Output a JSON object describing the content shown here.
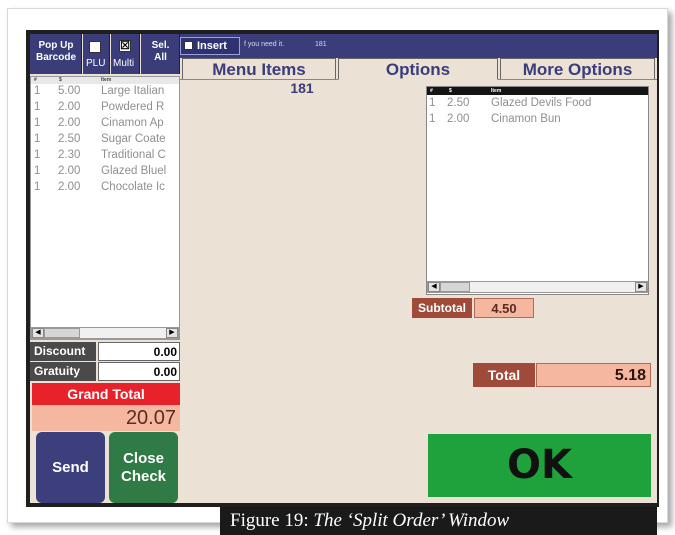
{
  "toolbar": {
    "popup_barcode": "Pop Up Barcode",
    "popup_line1": "Pop Up",
    "popup_line2": "Barcode",
    "plu_label": "PLU",
    "multi_label": "Multi",
    "multi_check": "☒",
    "sel_all_line1": "Sel.",
    "sel_all_line2": "All",
    "insert_label": "Insert",
    "hint_text": "f you need it.",
    "hint_number": "181"
  },
  "left_list": {
    "header": {
      "qty": "#",
      "price": "$",
      "item": "Item"
    },
    "rows": [
      {
        "qty": "1",
        "price": "5.00",
        "item": "Large Italian"
      },
      {
        "qty": "1",
        "price": "2.00",
        "item": "Powdered R"
      },
      {
        "qty": "1",
        "price": "2.00",
        "item": "Cinamon Ap"
      },
      {
        "qty": "1",
        "price": "2.50",
        "item": "Sugar Coate"
      },
      {
        "qty": "1",
        "price": "2.30",
        "item": "Traditional C"
      },
      {
        "qty": "1",
        "price": "2.00",
        "item": "Glazed Bluel"
      },
      {
        "qty": "1",
        "price": "2.00",
        "item": "Chocolate Ic"
      }
    ]
  },
  "summary": {
    "discount_label": "Discount",
    "discount_value": "0.00",
    "gratuity_label": "Gratuity",
    "gratuity_value": "0.00",
    "grand_total_label": "Grand Total",
    "grand_total_value": "20.07"
  },
  "buttons": {
    "send": "Send",
    "close_line1": "Close",
    "close_line2": "Check",
    "ok": "OK"
  },
  "tabs": [
    "Menu Items",
    "Options",
    "More Options"
  ],
  "order_number": "181",
  "options_list": {
    "header": {
      "qty": "#",
      "price": "$",
      "item": "Item"
    },
    "rows": [
      {
        "qty": "1",
        "price": "2.50",
        "item": "Glazed Devils Food"
      },
      {
        "qty": "1",
        "price": "2.00",
        "item": "Cinamon Bun"
      }
    ]
  },
  "totals": {
    "subtotal_label": "Subtotal",
    "subtotal_value": "4.50",
    "total_label": "Total",
    "total_value": "5.18"
  },
  "caption": {
    "prefix": "Figure 19: ",
    "title": "The ‘Split Order’ Window"
  },
  "colors": {
    "toolbar": "#3a3d7a",
    "panel": "#ebe1d4",
    "grand_total": "#e8222b",
    "ok": "#1fa23c",
    "send": "#3d3f7c",
    "close_check": "#2f7a45"
  }
}
